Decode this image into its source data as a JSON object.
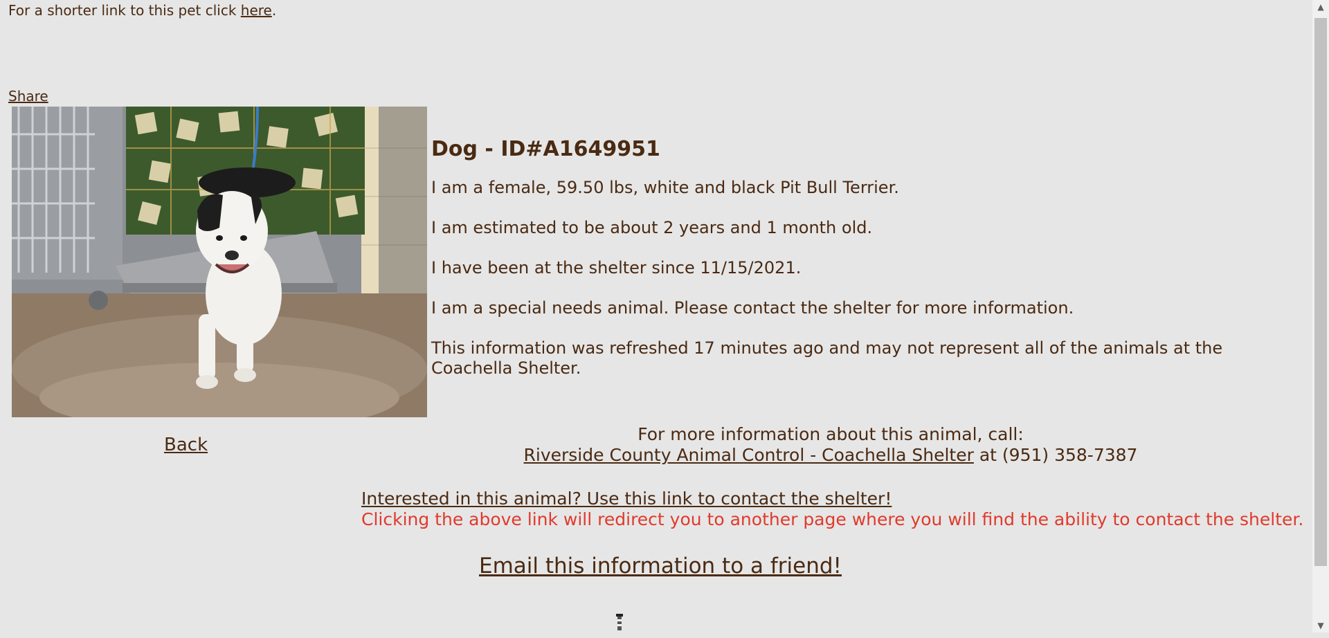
{
  "top": {
    "shorter_link_prefix": "For a shorter link to this pet click",
    "shorter_link_text": "here",
    "shorter_link_suffix": "."
  },
  "share_label": "Share",
  "pet": {
    "heading": "Dog - ID#A1649951",
    "line1": "I am a female, 59.50 lbs, white and black Pit Bull Terrier.",
    "line2": "I am estimated to be about 2 years and 1 month old.",
    "line3": "I have been at the shelter since 11/15/2021.",
    "line4": "I am a special needs animal. Please contact the shelter for more information.",
    "line5": "This information was refreshed 17 minutes ago and may not represent all of the animals at the Coachella Shelter."
  },
  "back_label": "Back",
  "contact": {
    "call_text": "For more information about this animal, call:",
    "shelter_link": "Riverside County Animal Control - Coachella Shelter",
    "phone_prefix": "at",
    "phone": "(951) 358-7387"
  },
  "interest": {
    "link_text": "Interested in this animal? Use this link to contact the shelter!",
    "redirect_note": "Clicking the above link will redirect you to another page where you will find the ability to contact the shelter."
  },
  "email_friend": "Email this information to a friend!",
  "icons": {
    "bottom_icon": "lighthouse-icon",
    "scroll_up": "scroll-up-arrow-icon",
    "scroll_down": "scroll-down-arrow-icon"
  },
  "colors": {
    "background": "#e6e6e6",
    "text_brown": "#4a2a12",
    "redirect_red": "#e03a2c"
  }
}
